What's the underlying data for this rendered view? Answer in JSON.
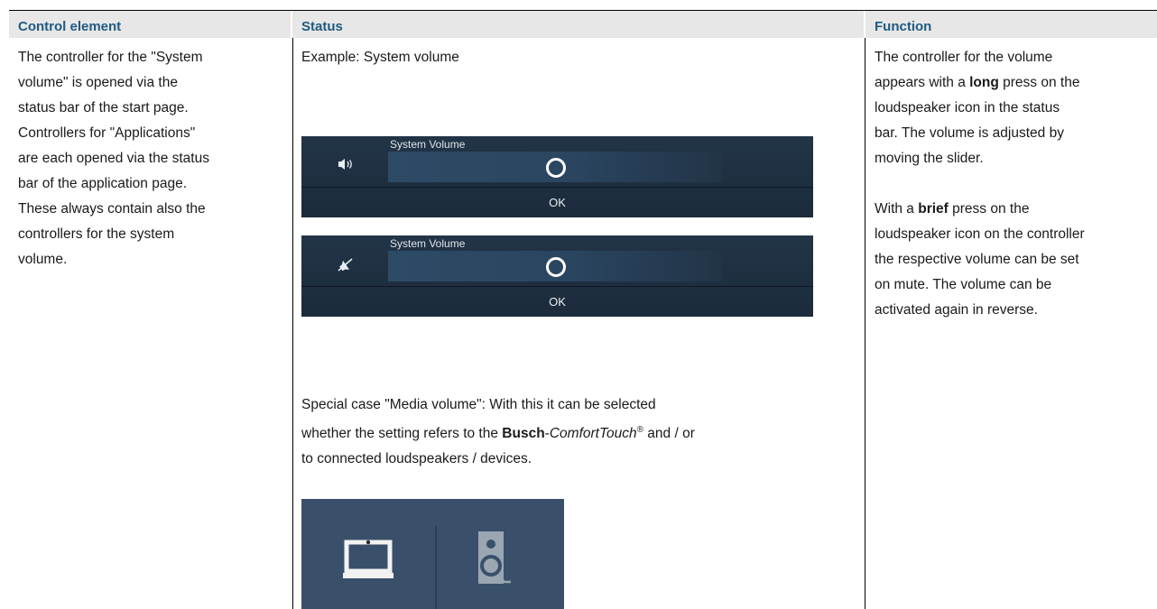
{
  "headers": {
    "control": "Control element",
    "status": "Status",
    "function": "Function"
  },
  "control_text": [
    "The controller for the \"System",
    "volume\" is opened via the",
    "status bar of the start page.",
    "Controllers for \"Applications\"",
    "are each opened via the status",
    "bar of the application page.",
    "These always contain also the",
    "controllers for the system",
    "volume."
  ],
  "status": {
    "example": "Example: System volume",
    "panel1": {
      "title": "System Volume",
      "ok": "OK",
      "icon": "speaker-icon"
    },
    "panel2": {
      "title": "System Volume",
      "ok": "OK",
      "icon": "speaker-muted-icon"
    },
    "special_line1": "Special case \"Media volume\": With this it can be selected",
    "special_pre": "whether the setting refers to the ",
    "special_brand_bold": "Busch",
    "special_brand_dash": "-",
    "special_brand_italic": "ComfortTouch",
    "special_reg": "®",
    "special_post": " and / or",
    "special_line3": "to connected loudspeakers / devices.",
    "media_icons": [
      "device-icon",
      "loudspeaker-device-icon"
    ]
  },
  "function": {
    "l1": "The controller for the volume",
    "l2_pre": "appears with a ",
    "l2_bold": "long",
    "l2_post": " press on the",
    "l3": "loudspeaker icon in the status",
    "l4": "bar. The volume is adjusted by",
    "l5": "moving the slider.",
    "l6_pre": "With a ",
    "l6_bold": "brief",
    "l6_post": " press on the",
    "l7": "loudspeaker icon on the controller",
    "l8": "the respective volume can be set",
    "l9": "on mute. The volume can be",
    "l10": "activated again in reverse."
  }
}
